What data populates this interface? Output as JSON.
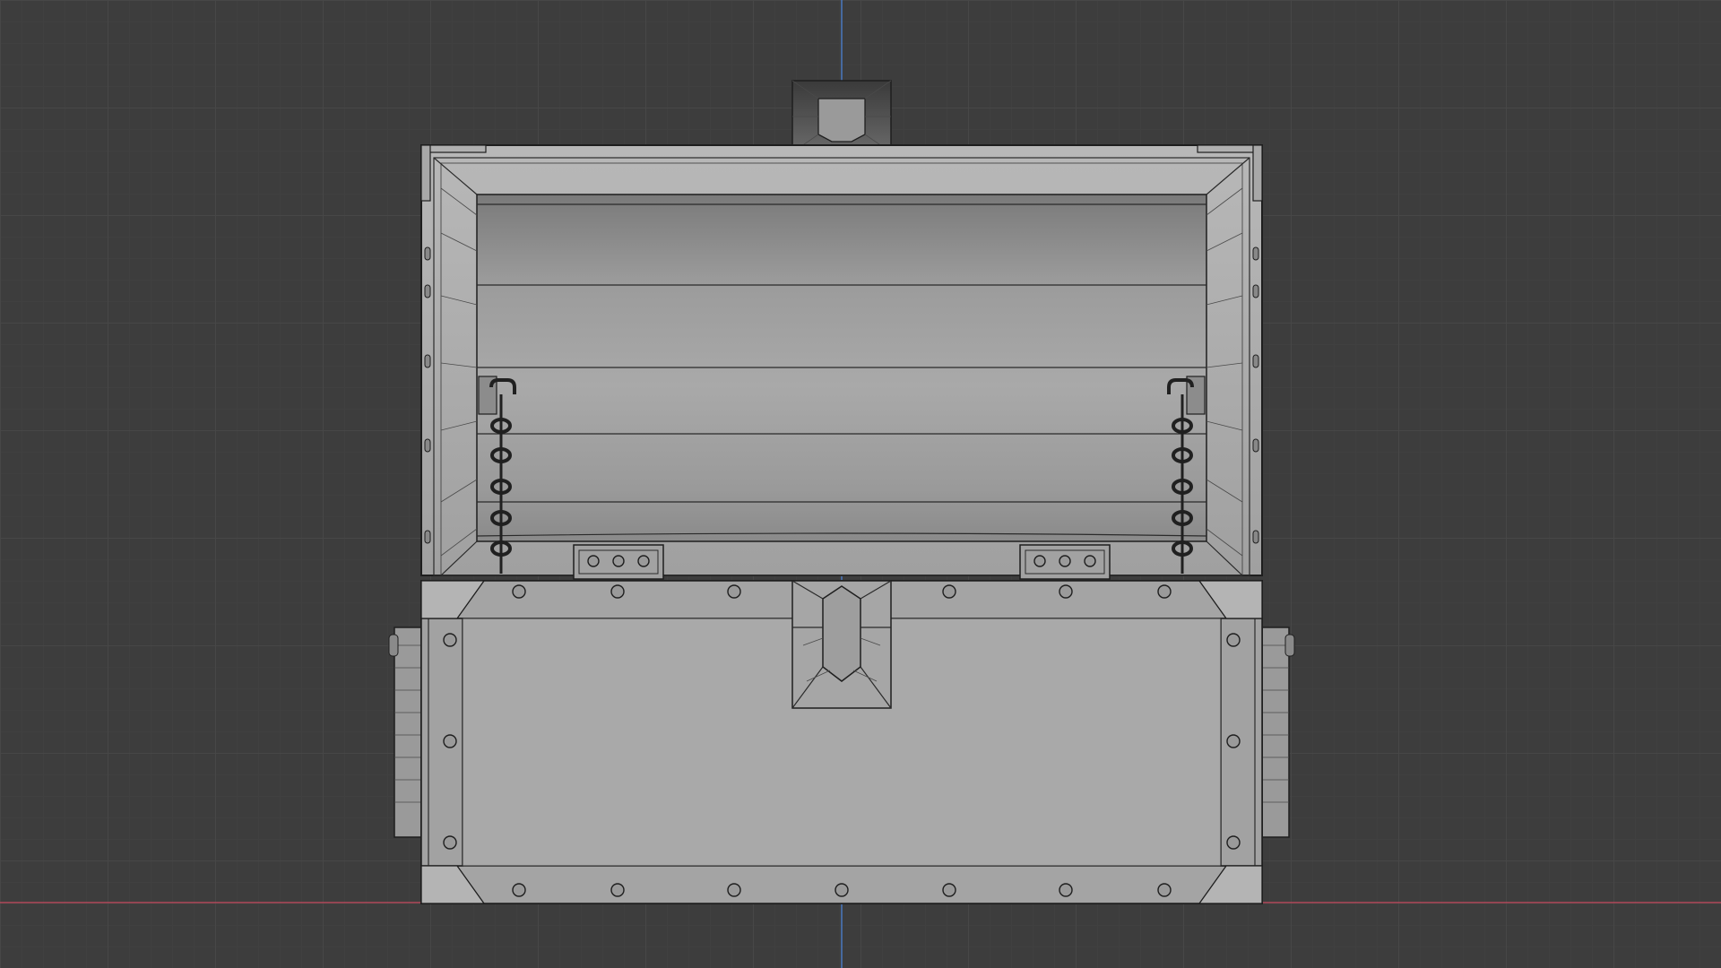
{
  "viewport": {
    "mode": "orthographic-front",
    "background_color": "#3d3d3d",
    "grid_major_color": "#474747",
    "grid_minor_color": "#404040",
    "x_axis_color": "#b0485a",
    "z_axis_color": "#4a78c0"
  },
  "model": {
    "object": "treasure-chest",
    "shading": "solid-gray-with-wireframe",
    "base_color": "#a6a6a6",
    "edge_color": "#222222"
  }
}
